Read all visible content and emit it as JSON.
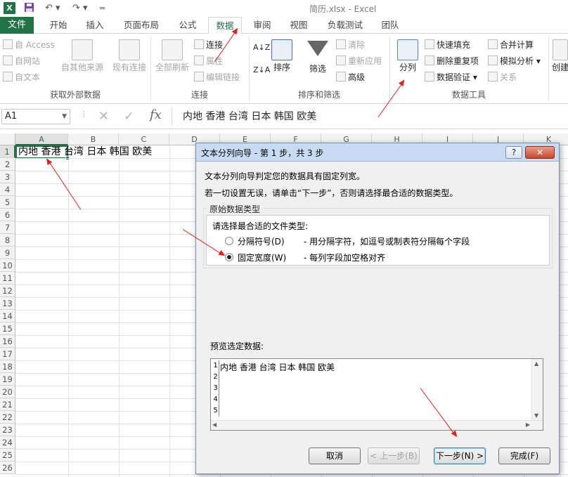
{
  "titlebar": {
    "title": "简历.xlsx - Excel",
    "logo": "X",
    "undo": "↶ ▾",
    "redo": "↷ ▾",
    "customize": "="
  },
  "tabs": [
    {
      "label": "文件"
    },
    {
      "label": "开始"
    },
    {
      "label": "插入"
    },
    {
      "label": "页面布局"
    },
    {
      "label": "公式"
    },
    {
      "label": "数据"
    },
    {
      "label": "审阅"
    },
    {
      "label": "视图"
    },
    {
      "label": "负载测试"
    },
    {
      "label": "团队"
    }
  ],
  "ribbon": {
    "external": {
      "access": "自 Access",
      "web": "自网站",
      "text": "自文本",
      "other": "自其他来源",
      "existing": "现有连接",
      "group": "获取外部数据"
    },
    "connections": {
      "refresh_all": "全部刷新",
      "connections": "连接",
      "properties": "属性",
      "edit_links": "编辑链接",
      "group": "连接"
    },
    "sort_filter": {
      "sort": "排序",
      "filter": "筛选",
      "clear": "清除",
      "reapply": "重新应用",
      "advanced": "高级",
      "group": "排序和筛选"
    },
    "data_tools": {
      "text_to_columns": "分列",
      "flash_fill": "快速填充",
      "remove_dup": "删除重复项",
      "validation": "数据验证",
      "consolidate": "合并计算",
      "what_if": "模拟分析",
      "relationships": "关系",
      "group": "数据工具"
    },
    "outline": {
      "create": "创建"
    }
  },
  "formula_bar": {
    "name_box": "A1",
    "cancel": "✕",
    "enter": "✓",
    "fx": "fx",
    "content": "内地 香港 台湾 日本 韩国 欧美"
  },
  "sheet": {
    "columns": [
      "A",
      "B",
      "C",
      "D",
      "E",
      "F",
      "G",
      "H",
      "I",
      "J",
      "K"
    ],
    "rows": [
      "1",
      "2",
      "3",
      "4",
      "5",
      "6",
      "7",
      "8",
      "9",
      "10",
      "11",
      "12",
      "13",
      "14",
      "15",
      "16",
      "17",
      "18",
      "19",
      "20",
      "21",
      "22",
      "23",
      "24",
      "25",
      "26"
    ],
    "a1_value": "内地 香港 台湾 日本 韩国 欧美"
  },
  "dialog": {
    "title": "文本分列向导 - 第 1 步，共 3 步",
    "help": "?",
    "close": "✕",
    "line1": "文本分列向导判定您的数据具有固定列宽。",
    "line2": "若一切设置无误，请单击“下一步”，否则请选择最合适的数据类型。",
    "legend": "原始数据类型",
    "choose": "请选择最合适的文件类型:",
    "opt1_label": "分隔符号(D)",
    "opt1_desc": "- 用分隔字符，如逗号或制表符分隔每个字段",
    "opt2_label": "固定宽度(W)",
    "opt2_desc": "- 每列字段加空格对齐",
    "preview_label": "预览选定数据:",
    "preview_rows": [
      "1",
      "2",
      "3",
      "4",
      "5"
    ],
    "preview_text": "内地 香港 台湾 日本 韩国 欧美",
    "btn_cancel": "取消",
    "btn_back": "< 上一步(B)",
    "btn_next": "下一步(N) >",
    "btn_finish": "完成(F)"
  },
  "colors": {
    "excel_green": "#217346",
    "arrow_red": "#e0221f",
    "dialog_title": "#c9dbf2"
  }
}
